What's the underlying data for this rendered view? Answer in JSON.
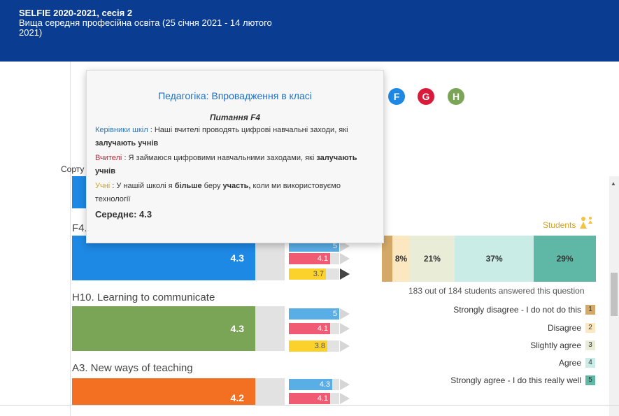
{
  "header": {
    "title": "SELFIE 2020-2021, сесія 2",
    "subtitle": "Вища середня професійна освіта (25 січня 2021 - 14 лютого 2021)"
  },
  "area_circles": [
    {
      "letter": "F",
      "color": "#1e88e5"
    },
    {
      "letter": "G",
      "color": "#d81b3b"
    },
    {
      "letter": "H",
      "color": "#7aa556"
    }
  ],
  "sort_label": "Сорту",
  "questions": [
    {
      "title": "F4.",
      "score": "4.3",
      "color": "#1e88e5",
      "mini": [
        {
          "value": "5",
          "fill": 1.0
        },
        {
          "value": "4.1",
          "fill": 0.82
        },
        {
          "value": "3.7",
          "fill": 0.74
        }
      ],
      "active_row": 2
    },
    {
      "title": "H10. Learning to communicate",
      "score": "4.3",
      "color": "#7aa556",
      "mini": [
        {
          "value": "5",
          "fill": 1.0
        },
        {
          "value": "4.1",
          "fill": 0.82
        },
        {
          "value": "3.8",
          "fill": 0.76
        }
      ]
    },
    {
      "title": "A3. New ways of teaching",
      "score": "4.2",
      "color": "#f36f21",
      "mini": [
        {
          "value": "4.3",
          "fill": 0.86
        },
        {
          "value": "4.1",
          "fill": 0.82
        }
      ]
    }
  ],
  "students_panel": {
    "label": "Students",
    "distribution": [
      {
        "level": 1,
        "percent": 5,
        "label": "",
        "color": "#d4a866"
      },
      {
        "level": 2,
        "percent": 8,
        "label": "8%",
        "color": "#fbe7c0"
      },
      {
        "level": 3,
        "percent": 21,
        "label": "21%",
        "color": "#e9edd8"
      },
      {
        "level": 4,
        "percent": 37,
        "label": "37%",
        "color": "#c9ece6"
      },
      {
        "level": 5,
        "percent": 29,
        "label": "29%",
        "color": "#5fb8a5"
      }
    ],
    "answered": "183 out of 184 students answered this question",
    "legend": [
      {
        "label": "Strongly disagree - I do not do this",
        "num": "1",
        "color": "#d4a866"
      },
      {
        "label": "Disagree",
        "num": "2",
        "color": "#fbe7c0"
      },
      {
        "label": "Slightly agree",
        "num": "3",
        "color": "#e9edd8"
      },
      {
        "label": "Agree",
        "num": "4",
        "color": "#c9ece6"
      },
      {
        "label": "Strongly agree - I do this really well",
        "num": "5",
        "color": "#5fb8a5"
      }
    ]
  },
  "tooltip": {
    "title": "Педагогіка: Впровадження в класі",
    "question": "Питання F4",
    "leaders_label": "Керівники шкіл",
    "leaders_text_1": " : Наші вчителі проводять цифрові навчальні заходи, які ",
    "leaders_bold": "залучають учнів",
    "teachers_label": "Вчителі",
    "teachers_text_1": " : Я займаюся цифровими навчальними заходами, які ",
    "teachers_bold": "залучають учнів",
    "students_label": "Учні",
    "students_text_1": " : У нашій школі я ",
    "students_bold_1": "більше",
    "students_text_2": " беру ",
    "students_bold_2": "участь,",
    "students_text_3": " коли ми використовуємо технології",
    "average": "Середнє: 4.3"
  }
}
